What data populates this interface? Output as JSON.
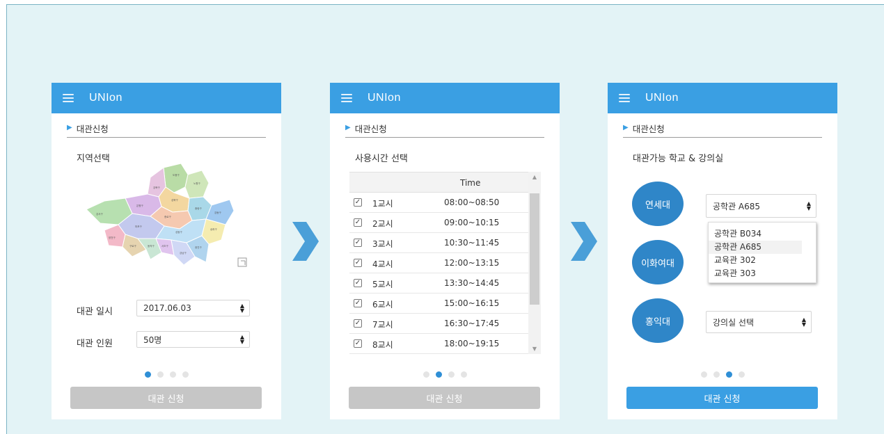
{
  "app": {
    "title": "UNIon"
  },
  "section_label": "대관신청",
  "submit_label": "대관 신청",
  "colors": {
    "primary": "#3a9fe3",
    "circle": "#2f86c8",
    "disabled": "#c6c6c6",
    "background": "#e3f3f6"
  },
  "screen1": {
    "subtitle": "지역선택",
    "map": {
      "icon": "seoul-district-map"
    },
    "date_label": "대관 일시",
    "date_value": "2017.06.03",
    "people_label": "대관 인원",
    "people_value": "50명",
    "step": 1,
    "submit_enabled": false
  },
  "screen2": {
    "subtitle": "사용시간 선택",
    "time_header": "Time",
    "rows": [
      {
        "period": "1교시",
        "time": "08:00~08:50",
        "checked": true
      },
      {
        "period": "2교시",
        "time": "09:00~10:15",
        "checked": true
      },
      {
        "period": "3교시",
        "time": "10:30~11:45",
        "checked": true
      },
      {
        "period": "4교시",
        "time": "12:00~13:15",
        "checked": true
      },
      {
        "period": "5교시",
        "time": "13:30~14:45",
        "checked": true
      },
      {
        "period": "6교시",
        "time": "15:00~16:15",
        "checked": true
      },
      {
        "period": "7교시",
        "time": "16:30~17:45",
        "checked": true
      },
      {
        "period": "8교시",
        "time": "18:00~19:15",
        "checked": true
      }
    ],
    "step": 2,
    "submit_enabled": false
  },
  "screen3": {
    "subtitle": "대관가능 학교 & 강의실",
    "schools": [
      "연세대",
      "이화여대",
      "홍익대"
    ],
    "room_select_1": "공학관 A685",
    "room_options": [
      "공학관 B034",
      "공학관 A685",
      "교육관 302",
      "교육관 303"
    ],
    "room_select_3": "강의실 선택",
    "step": 3,
    "submit_enabled": true
  }
}
